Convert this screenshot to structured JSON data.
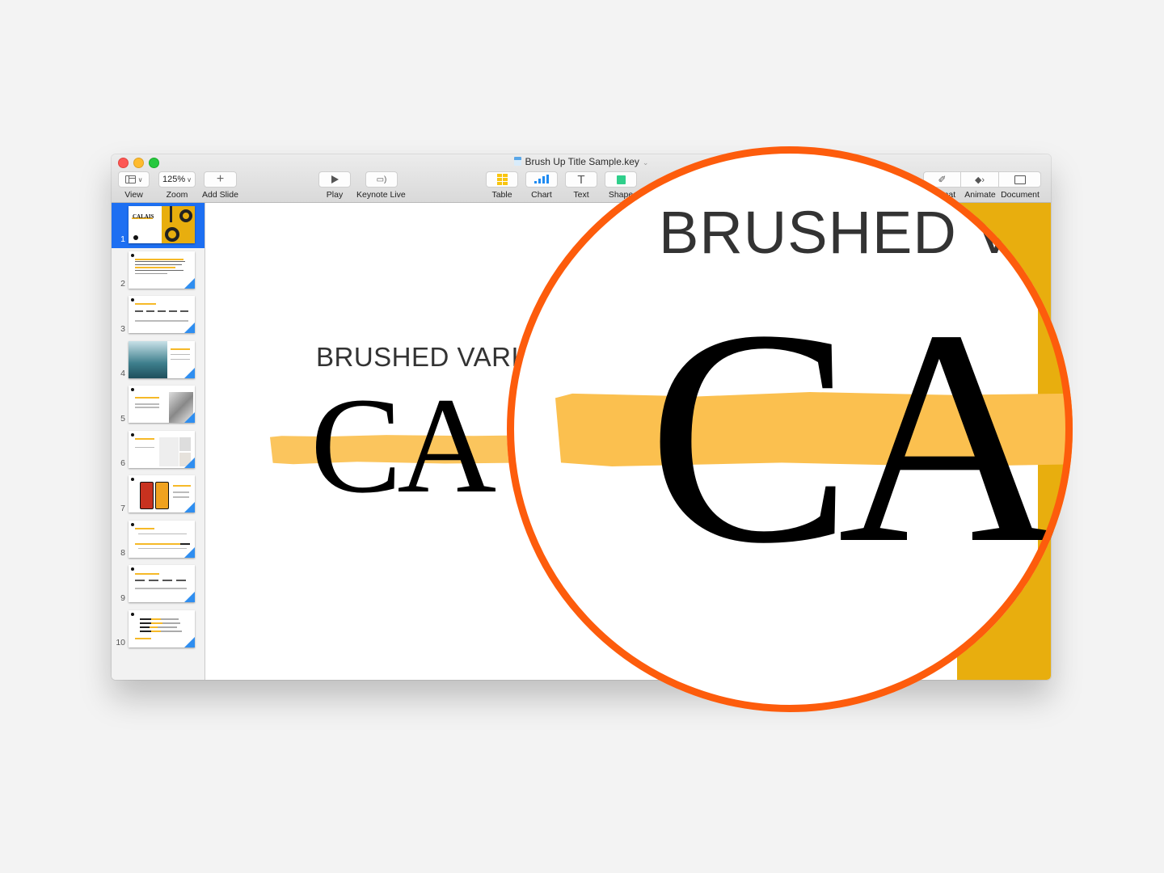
{
  "window": {
    "document_title": "Brush Up Title Sample.key",
    "traffic_lights": [
      "close",
      "minimize",
      "maximize"
    ]
  },
  "toolbar": {
    "view_label": "View",
    "zoom_value": "125%",
    "zoom_label": "Zoom",
    "add_slide_label": "Add Slide",
    "play_label": "Play",
    "keynote_live_label": "Keynote Live",
    "table_label": "Table",
    "chart_label": "Chart",
    "text_label": "Text",
    "shape_label": "Shape",
    "format_label": "Format",
    "animate_label": "Animate",
    "document_label": "Document"
  },
  "colors": {
    "selection_blue": "#1d6ff2",
    "brush_yellow": "#fbc04f",
    "slide_yellow": "#e8ae0e",
    "loupe_orange": "#fd5c0c"
  },
  "sidebar": {
    "selected_index": 1,
    "slides": [
      {
        "number": "1"
      },
      {
        "number": "2"
      },
      {
        "number": "3"
      },
      {
        "number": "4"
      },
      {
        "number": "5"
      },
      {
        "number": "6"
      },
      {
        "number": "7"
      },
      {
        "number": "8"
      },
      {
        "number": "9"
      },
      {
        "number": "10"
      }
    ],
    "slide1_thumb_title": "CALAIS"
  },
  "slide": {
    "subtitle": "BRUSHED VARI",
    "title": "CA"
  },
  "magnifier": {
    "subtitle": "BRUSHED V",
    "title": "CA"
  }
}
